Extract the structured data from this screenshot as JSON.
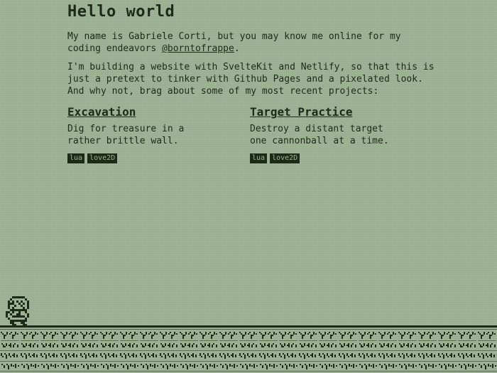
{
  "heading": "Hello world",
  "intro": {
    "text_before": "My name is Gabriele Corti, but you may know me online for my coding endeavors ",
    "handle": "@borntofrappe",
    "text_after": "."
  },
  "intro2": {
    "line1": "I'm building a website with SvelteKit and Netlify, so that this is just a pretext to tinker with Github Pages and a pixelated look.",
    "line2": "And why not, brag about some of my most recent projects:"
  },
  "projects": [
    {
      "title": "Excavation",
      "description": "Dig for treasure in a rather brittle wall.",
      "tags": [
        "lua",
        "love2D"
      ]
    },
    {
      "title": "Target Practice",
      "description": "Destroy a distant target one cannonball at a time.",
      "tags": [
        "lua",
        "love2D"
      ]
    }
  ],
  "colors": {
    "background": "#9db294",
    "foreground": "#1e2a18"
  },
  "decor": {
    "character": "pixel-character-icon",
    "ground": "pixel-grass-icon"
  }
}
